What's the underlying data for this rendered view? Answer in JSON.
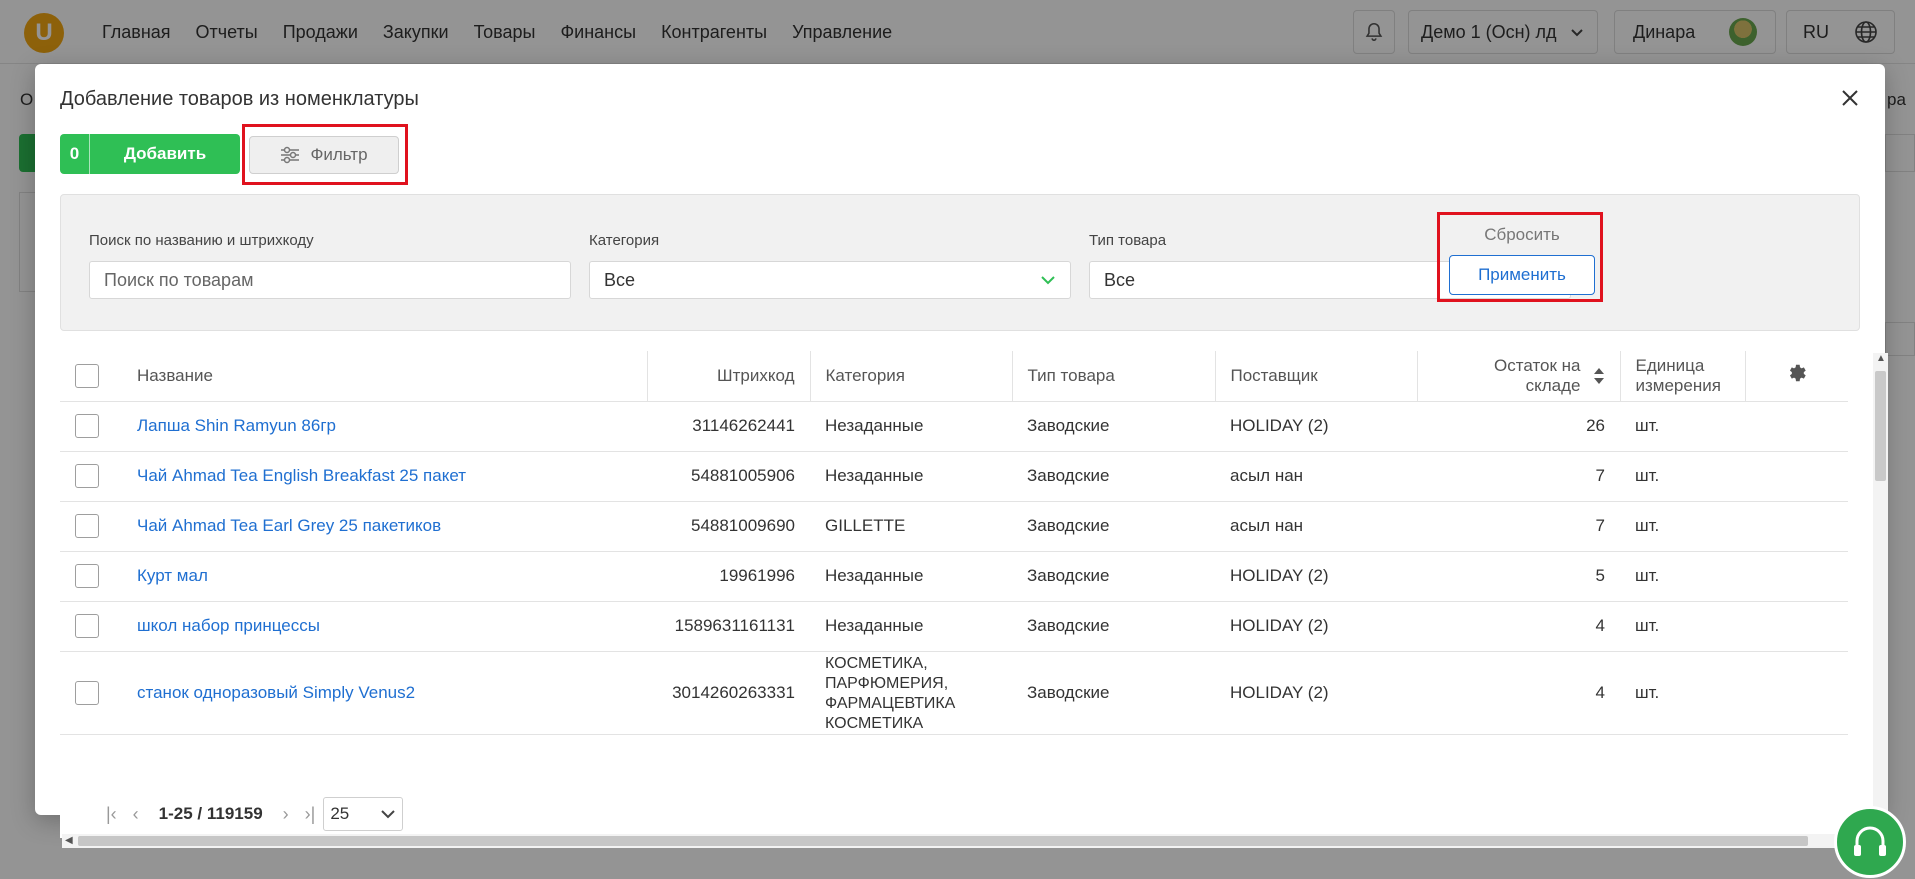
{
  "topbar": {
    "logo_letter": "U",
    "nav": [
      "Главная",
      "Отчеты",
      "Продажи",
      "Закупки",
      "Товары",
      "Финансы",
      "Контрагенты",
      "Управление"
    ],
    "org_label": "Демо 1 (Осн) лд",
    "user_name": "Динара",
    "lang": "RU"
  },
  "background": {
    "left_letter": "О",
    "right_text": "ра"
  },
  "modal": {
    "title": "Добавление товаров из номенклатуры",
    "add_count": "0",
    "add_label": "Добавить",
    "filter_label": "Фильтр"
  },
  "filters": {
    "search_label": "Поиск по названию и штрихкоду",
    "search_placeholder": "Поиск по товарам",
    "category_label": "Категория",
    "category_value": "Все",
    "type_label": "Тип товара",
    "type_value": "Все",
    "reset_label": "Сбросить",
    "apply_label": "Применить"
  },
  "table": {
    "headers": {
      "name": "Название",
      "barcode": "Штрихкод",
      "category": "Категория",
      "type": "Тип товара",
      "supplier": "Поставщик",
      "stock": "Остаток на складе",
      "unit": "Единица измерения"
    },
    "rows": [
      {
        "name": "Лапша Shin Ramyun 86гр",
        "barcode": "31146262441",
        "category": "Незаданные",
        "type": "Заводские",
        "supplier": "HOLIDAY (2)",
        "stock": "26",
        "unit": "шт."
      },
      {
        "name": "Чай Ahmad Tea English Breakfast 25 пакет",
        "barcode": "54881005906",
        "category": "Незаданные",
        "type": "Заводские",
        "supplier": "асыл нан",
        "stock": "7",
        "unit": "шт."
      },
      {
        "name": "Чай Ahmad Tea Earl Grey 25 пакетиков",
        "barcode": "54881009690",
        "category": "GILLETTE",
        "type": "Заводские",
        "supplier": "асыл нан",
        "stock": "7",
        "unit": "шт."
      },
      {
        "name": "Курт мал",
        "barcode": "19961996",
        "category": "Незаданные",
        "type": "Заводские",
        "supplier": "HOLIDAY (2)",
        "stock": "5",
        "unit": "шт."
      },
      {
        "name": "школ набор принцессы",
        "barcode": "1589631161131",
        "category": "Незаданные",
        "type": "Заводские",
        "supplier": "HOLIDAY (2)",
        "stock": "4",
        "unit": "шт."
      },
      {
        "name": "станок одноразовый Simply Venus2",
        "barcode": "3014260263331",
        "category": "КОСМЕТИКА, ПАРФЮМЕРИЯ, ФАРМАЦЕВТИКА КОСМЕТИКА",
        "type": "Заводские",
        "supplier": "HOLIDAY (2)",
        "stock": "4",
        "unit": "шт."
      }
    ]
  },
  "pager": {
    "range": "1-25 / 119159",
    "page_size": "25"
  }
}
